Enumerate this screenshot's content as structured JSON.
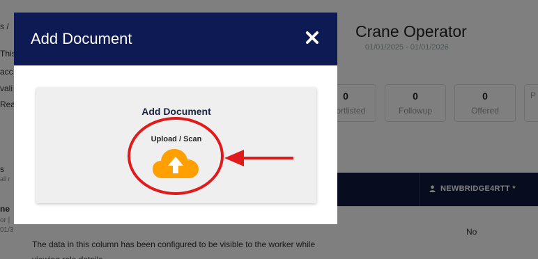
{
  "left_panel": {
    "lines": [
      "s /",
      "This",
      "acc",
      "vali",
      "Rea",
      "s",
      "all r",
      "ne",
      "or |",
      "01/3"
    ]
  },
  "role": {
    "title": "Crane Operator",
    "dates": "01/01/2025 - 01/01/2026"
  },
  "stats": [
    {
      "value": "0",
      "label": "Shortlisted"
    },
    {
      "value": "0",
      "label": "Followup"
    },
    {
      "value": "0",
      "label": "Offered"
    },
    {
      "value": "",
      "label": "P"
    }
  ],
  "table": {
    "column_header": "NEWBRIDGE4RTT *",
    "cell_value": "No"
  },
  "note_text": "The data in this column has been configured to be visible to the worker while viewing role details",
  "modal": {
    "title": "Add Document",
    "close_icon": "×",
    "card_title": "Add Document",
    "card_subtitle": "Upload / Scan",
    "upload_icon": "cloud-upload-icon"
  },
  "colors": {
    "header_navy": "#0e1a54",
    "table_navy": "#0e1a3f",
    "upload_orange": "#ffa000",
    "annotation_red": "#e01b1b"
  }
}
